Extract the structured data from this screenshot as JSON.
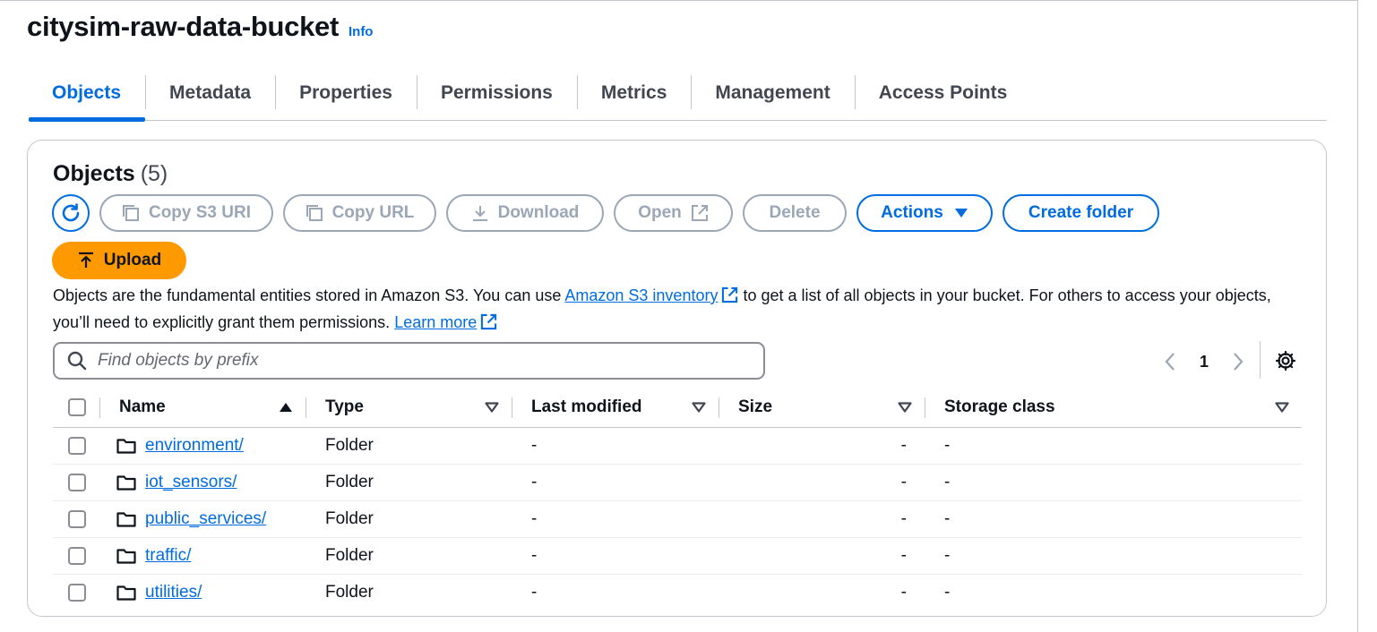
{
  "bucket": {
    "name": "citysim-raw-data-bucket",
    "info_label": "Info"
  },
  "tabs": [
    {
      "label": "Objects",
      "active": true
    },
    {
      "label": "Metadata",
      "active": false
    },
    {
      "label": "Properties",
      "active": false
    },
    {
      "label": "Permissions",
      "active": false
    },
    {
      "label": "Metrics",
      "active": false
    },
    {
      "label": "Management",
      "active": false
    },
    {
      "label": "Access Points",
      "active": false
    }
  ],
  "objects_panel": {
    "heading": "Objects",
    "count": "(5)",
    "buttons": {
      "refresh_icon": "refresh-icon",
      "copy_s3_uri": "Copy S3 URI",
      "copy_url": "Copy URL",
      "download": "Download",
      "open": "Open",
      "delete": "Delete",
      "actions": "Actions",
      "create_folder": "Create folder",
      "upload": "Upload"
    },
    "description": {
      "part1": "Objects are the fundamental entities stored in Amazon S3. You can use ",
      "link1": "Amazon S3 inventory",
      "part2": " to get a list of all objects in your bucket. For others to access your objects, you’ll need to explicitly grant them permissions. ",
      "link2": "Learn more"
    },
    "search": {
      "placeholder": "Find objects by prefix",
      "value": ""
    },
    "pagination": {
      "current_page": "1"
    },
    "columns": [
      "Name",
      "Type",
      "Last modified",
      "Size",
      "Storage class"
    ],
    "rows": [
      {
        "name": "environment/",
        "type": "Folder",
        "last_modified": "-",
        "size": "-",
        "storage_class": "-"
      },
      {
        "name": "iot_sensors/",
        "type": "Folder",
        "last_modified": "-",
        "size": "-",
        "storage_class": "-"
      },
      {
        "name": "public_services/",
        "type": "Folder",
        "last_modified": "-",
        "size": "-",
        "storage_class": "-"
      },
      {
        "name": "traffic/",
        "type": "Folder",
        "last_modified": "-",
        "size": "-",
        "storage_class": "-"
      },
      {
        "name": "utilities/",
        "type": "Folder",
        "last_modified": "-",
        "size": "-",
        "storage_class": "-"
      }
    ]
  },
  "colors": {
    "accent": "#006ce0",
    "upload": "#ff9900",
    "disabled": "#9ba7b6",
    "text": "#0f141a"
  }
}
